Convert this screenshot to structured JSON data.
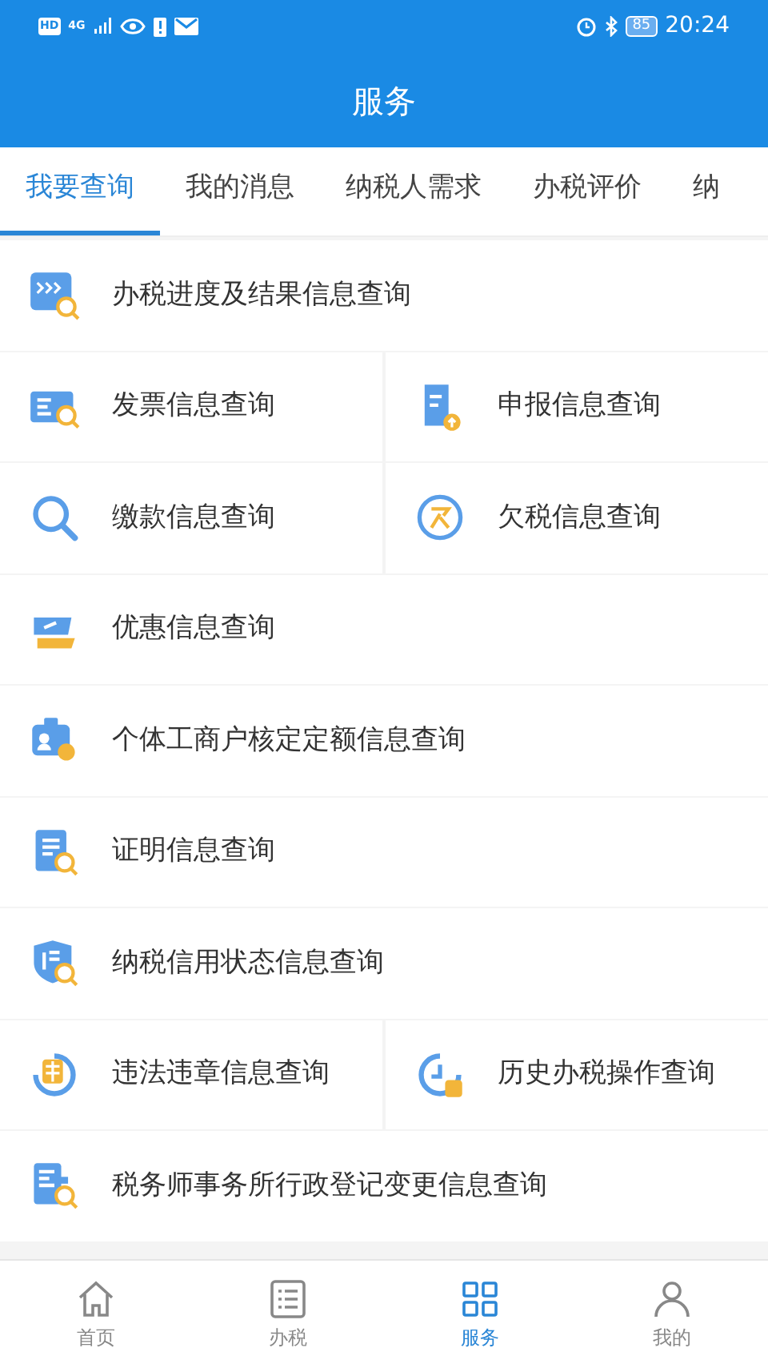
{
  "status_bar": {
    "hd": "HD",
    "network": "4G",
    "battery": "85",
    "time": "20:24"
  },
  "header": {
    "title": "服务"
  },
  "tabs": [
    {
      "label": "我要查询",
      "selected": true
    },
    {
      "label": "我的消息",
      "selected": false
    },
    {
      "label": "纳税人需求",
      "selected": false
    },
    {
      "label": "办税评价",
      "selected": false
    },
    {
      "label": "纳",
      "selected": false
    }
  ],
  "rows": [
    {
      "cells": [
        {
          "label": "办税进度及结果信息查询"
        }
      ]
    },
    {
      "cells": [
        {
          "label": "发票信息查询"
        },
        {
          "label": "申报信息查询"
        }
      ]
    },
    {
      "cells": [
        {
          "label": "缴款信息查询"
        },
        {
          "label": "欠税信息查询"
        }
      ]
    },
    {
      "cells": [
        {
          "label": "优惠信息查询"
        }
      ]
    },
    {
      "cells": [
        {
          "label": "个体工商户核定定额信息查询"
        }
      ]
    },
    {
      "cells": [
        {
          "label": "证明信息查询"
        }
      ]
    },
    {
      "cells": [
        {
          "label": "纳税信用状态信息查询"
        }
      ]
    },
    {
      "cells": [
        {
          "label": "违法违章信息查询"
        },
        {
          "label": "历史办税操作查询"
        }
      ]
    },
    {
      "cells": [
        {
          "label": "税务师事务所行政登记变更信息查询"
        }
      ]
    }
  ],
  "bottom_nav": [
    {
      "label": "首页",
      "selected": false
    },
    {
      "label": "办税",
      "selected": false
    },
    {
      "label": "服务",
      "selected": true
    },
    {
      "label": "我的",
      "selected": false
    }
  ]
}
